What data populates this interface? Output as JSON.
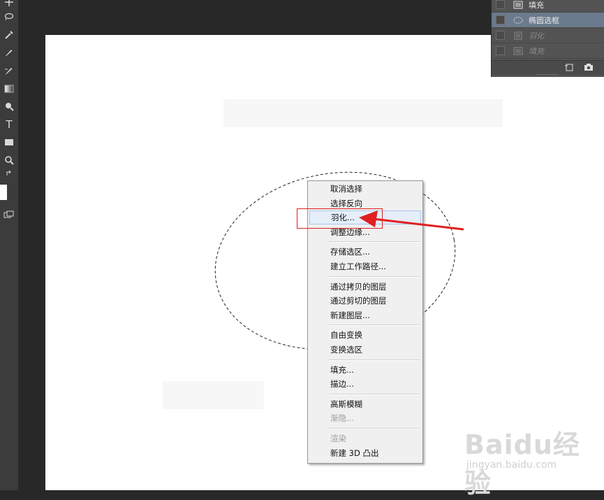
{
  "layers_panel": {
    "layers": [
      {
        "name": "填充",
        "type": "fill-layer",
        "selected": false,
        "dimmed": false
      },
      {
        "name": "椭圆选框",
        "type": "ellipse-marquee",
        "selected": true,
        "dimmed": false
      },
      {
        "name": "羽化",
        "type": "fill-layer",
        "selected": false,
        "dimmed": true
      },
      {
        "name": "填充",
        "type": "fill-layer",
        "selected": false,
        "dimmed": true
      }
    ],
    "footer_icons": [
      "new-document-icon",
      "camera-icon"
    ]
  },
  "context_menu": {
    "groups": [
      [
        {
          "label": "取消选择",
          "enabled": true
        },
        {
          "label": "选择反向",
          "enabled": true
        },
        {
          "label": "羽化...",
          "enabled": true,
          "hover": true
        },
        {
          "label": "调整边缘...",
          "enabled": true
        }
      ],
      [
        {
          "label": "存储选区...",
          "enabled": true
        },
        {
          "label": "建立工作路径...",
          "enabled": true
        }
      ],
      [
        {
          "label": "通过拷贝的图层",
          "enabled": true
        },
        {
          "label": "通过剪切的图层",
          "enabled": true
        },
        {
          "label": "新建图层...",
          "enabled": true
        }
      ],
      [
        {
          "label": "自由变换",
          "enabled": true
        },
        {
          "label": "变换选区",
          "enabled": true
        }
      ],
      [
        {
          "label": "填充...",
          "enabled": true
        },
        {
          "label": "描边...",
          "enabled": true
        }
      ],
      [
        {
          "label": "高斯模糊",
          "enabled": true
        },
        {
          "label": "渐隐...",
          "enabled": false
        }
      ],
      [
        {
          "label": "渲染",
          "enabled": false
        },
        {
          "label": "新建 3D 凸出",
          "enabled": true
        }
      ]
    ]
  },
  "toolbar": {
    "tools": [
      "move-icon",
      "lasso-icon",
      "eyedropper-icon",
      "brush-icon",
      "history-brush-icon",
      "gradient-icon",
      "dodge-icon",
      "type-icon",
      "rectangle-icon",
      "zoom-icon",
      "swap-colors-icon",
      "screen-mode-icon"
    ],
    "type_tool_glyph": "T"
  },
  "watermark": {
    "main": "Baidu经验",
    "sub": "jingyan.baidu.com"
  },
  "colors": {
    "annotation": "#e02020",
    "menu_hover": "#e5eef9",
    "selected_layer": "#6b7a8c"
  }
}
